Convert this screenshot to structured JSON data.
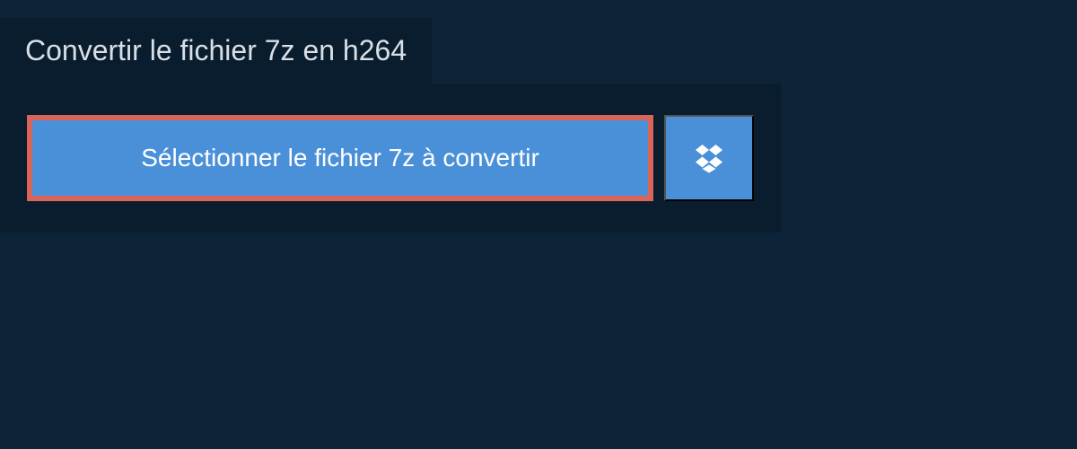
{
  "header": {
    "title": "Convertir le fichier 7z en h264"
  },
  "actions": {
    "select_file_label": "Sélectionner le fichier 7z à convertir"
  },
  "colors": {
    "background": "#0d2438",
    "panel": "#0a1d2e",
    "button": "#4a90d9",
    "highlight_border": "#d9645a",
    "text_light": "#d8dfe6",
    "text_white": "#ffffff"
  }
}
